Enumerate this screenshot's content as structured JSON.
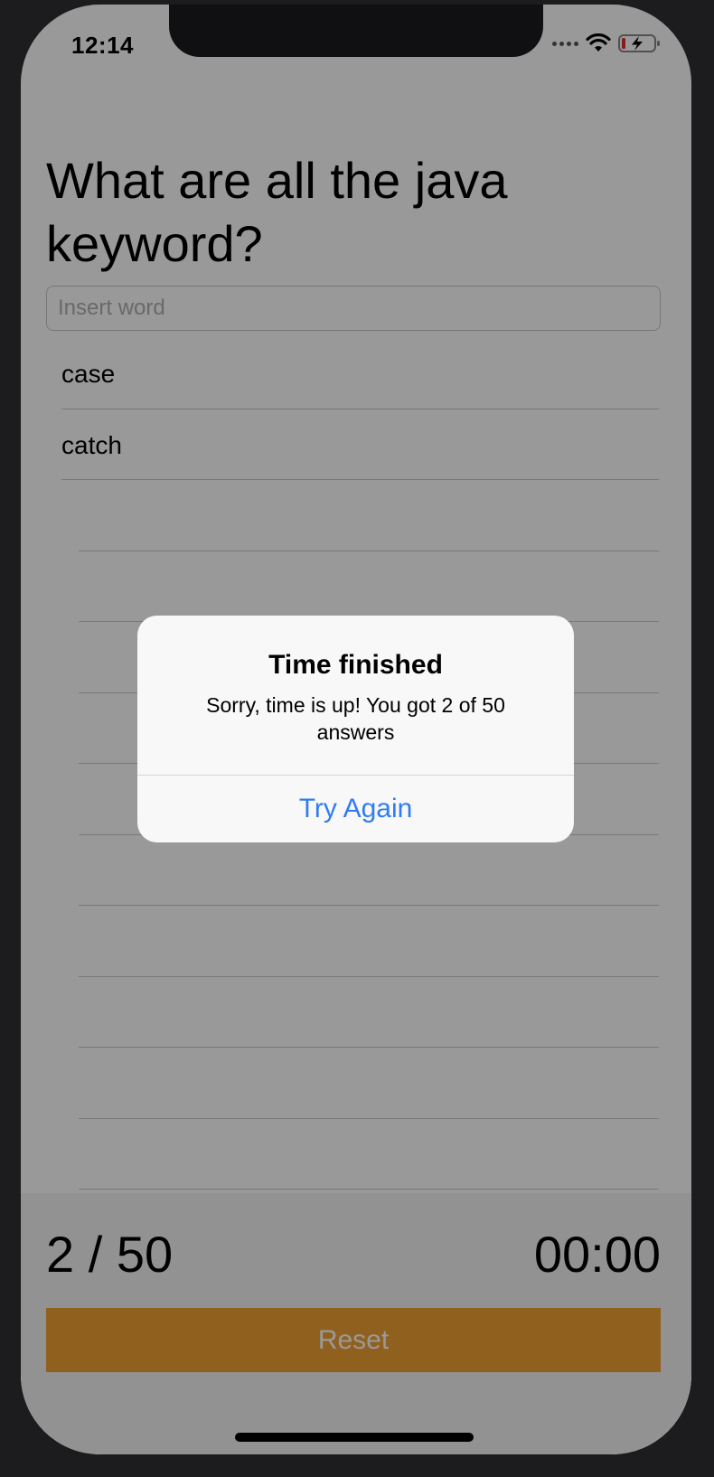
{
  "status_bar": {
    "time": "12:14"
  },
  "question": "What are all the java keyword?",
  "input": {
    "placeholder": "Insert word",
    "value": ""
  },
  "answers": [
    "case",
    "catch",
    "",
    "",
    "",
    "",
    "",
    "",
    "",
    "",
    "",
    ""
  ],
  "footer": {
    "score": "2 / 50",
    "timer": "00:00",
    "reset_label": "Reset"
  },
  "alert": {
    "title": "Time finished",
    "message": "Sorry, time is up! You got 2 of 50 answers",
    "action_label": "Try Again"
  },
  "colors": {
    "accent": "#f0a035",
    "link": "#2f7cf6",
    "dim_overlay": "rgba(0,0,0,0.4)"
  }
}
